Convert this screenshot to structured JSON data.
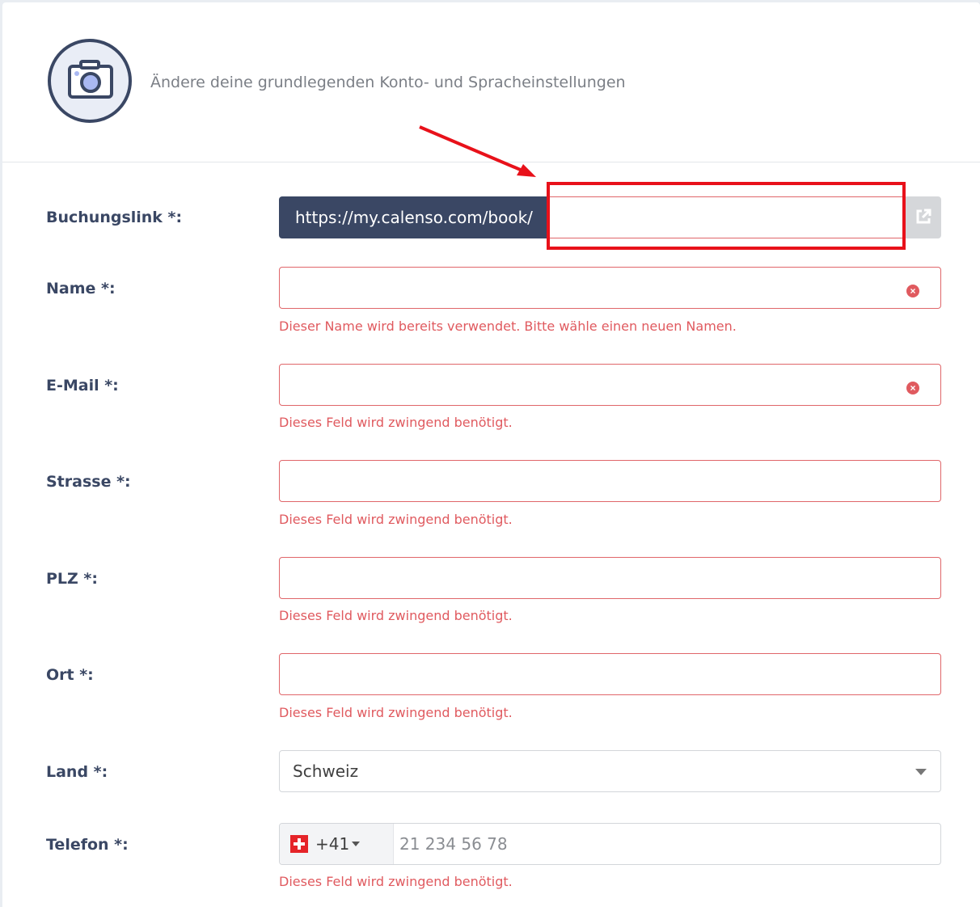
{
  "header": {
    "subtitle": "Ändere deine grundlegenden Konto- und Spracheinstellungen",
    "avatar_icon": "camera-icon"
  },
  "form": {
    "booking_link": {
      "label": "Buchungslink *:",
      "prefix": "https://my.calenso.com/book/",
      "value": "",
      "open_icon": "external-link-icon"
    },
    "name": {
      "label": "Name *:",
      "value": "",
      "error": "Dieser Name wird bereits verwendet. Bitte wähle einen neuen Namen."
    },
    "email": {
      "label": "E-Mail *:",
      "value": "",
      "error": "Dieses Feld wird zwingend benötigt."
    },
    "street": {
      "label": "Strasse *:",
      "value": "",
      "error": "Dieses Feld wird zwingend benötigt."
    },
    "zip": {
      "label": "PLZ *:",
      "value": "",
      "error": "Dieses Feld wird zwingend benötigt."
    },
    "city": {
      "label": "Ort *:",
      "value": "",
      "error": "Dieses Feld wird zwingend benötigt."
    },
    "country": {
      "label": "Land *:",
      "selected": "Schweiz"
    },
    "phone": {
      "label": "Telefon *:",
      "dial_code": "+41",
      "placeholder": "21 234 56 78",
      "flag_icon": "swiss-flag-icon",
      "error": "Dieses Feld wird zwingend benötigt."
    }
  },
  "colors": {
    "primary": "#3a4764",
    "error": "#e05a5f",
    "annotation": "#e8111a"
  }
}
